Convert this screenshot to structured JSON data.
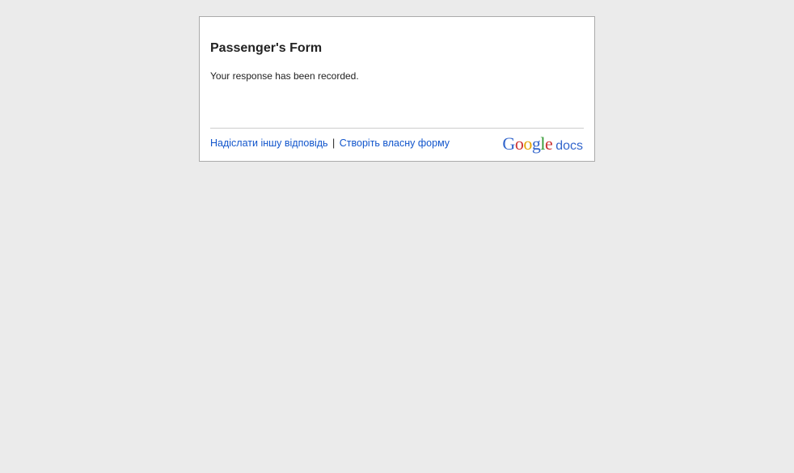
{
  "form": {
    "title": "Passenger's Form",
    "message": "Your response has been recorded."
  },
  "footer": {
    "submit_another_label": "Надіслати іншу відповідь",
    "separator": "|",
    "create_form_label": "Створіть власну форму"
  },
  "logo": {
    "letters": [
      {
        "char": "G",
        "color": "#3366cc"
      },
      {
        "char": "o",
        "color": "#cc3333"
      },
      {
        "char": "o",
        "color": "#e6a300"
      },
      {
        "char": "g",
        "color": "#3366cc"
      },
      {
        "char": "l",
        "color": "#339933"
      },
      {
        "char": "e",
        "color": "#cc3333"
      }
    ],
    "suffix": "docs",
    "suffix_color": "#3366cc"
  },
  "colors": {
    "background": "#ebebeb",
    "card": "#ffffff",
    "link": "#1155cc"
  }
}
